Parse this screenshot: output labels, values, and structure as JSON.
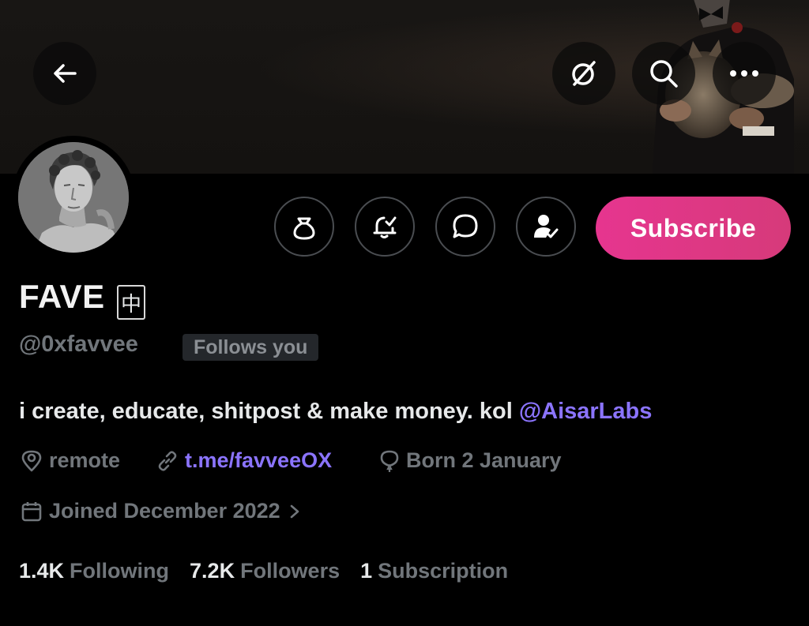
{
  "profile": {
    "name": "FAVE",
    "name_badge": "中",
    "handle": "@0xfavvee",
    "follows_you": "Follows you",
    "bio_text": "i create, educate, shitpost & make money. kol ",
    "bio_mention": "@AisarLabs",
    "location": "remote",
    "website": "t.me/favveeOX",
    "birthday": "Born 2 January",
    "joined": "Joined December 2022"
  },
  "actions": {
    "subscribe_label": "Subscribe"
  },
  "stats": {
    "following_count": "1.4K",
    "following_label": "Following",
    "followers_count": "7.2K",
    "followers_label": "Followers",
    "subscription_count": "1",
    "subscription_label": "Subscription"
  },
  "icons": {
    "back": "back-arrow-icon",
    "grok": "grok-icon",
    "search": "search-icon",
    "more": "more-icon",
    "tip": "tip-money-bag-icon",
    "notify": "bell-check-icon",
    "message": "message-icon",
    "following": "person-check-icon",
    "location": "location-pin-icon",
    "link": "link-icon",
    "birthday": "balloon-icon",
    "calendar": "calendar-icon",
    "chevron": "chevron-right-icon"
  },
  "colors": {
    "accent_link": "#8b74ff",
    "subscribe_gradient_start": "#e6358f",
    "subscribe_gradient_end": "#d63a7a",
    "muted_text": "#71767b"
  }
}
